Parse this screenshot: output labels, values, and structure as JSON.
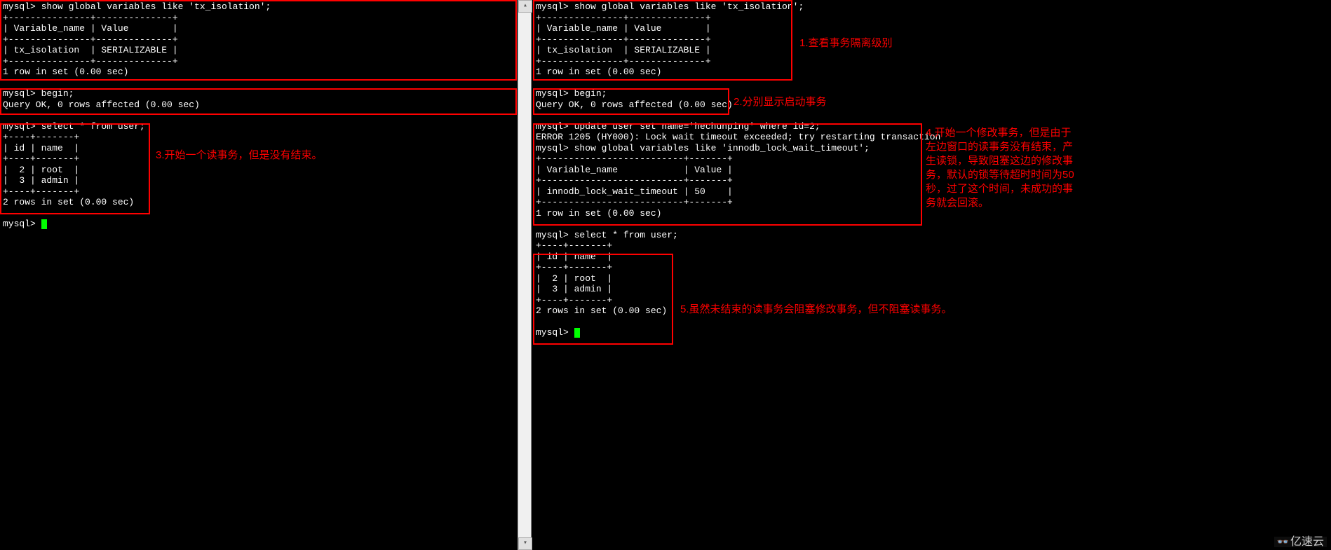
{
  "left": {
    "line1": "mysql> show global variables like 'tx_isolation';",
    "line2": "+---------------+--------------+",
    "line3": "| Variable_name | Value        |",
    "line4": "+---------------+--------------+",
    "line5": "| tx_isolation  | SERIALIZABLE |",
    "line6": "+---------------+--------------+",
    "line7": "1 row in set (0.00 sec)",
    "blank1": "",
    "line8": "mysql> begin;",
    "line9": "Query OK, 0 rows affected (0.00 sec)",
    "blank2": "",
    "line10": "mysql> select * from user;",
    "line11": "+----+-------+",
    "line12": "| id | name  |",
    "line13": "+----+-------+",
    "line14": "|  2 | root  |",
    "line15": "|  3 | admin |",
    "line16": "+----+-------+",
    "line17": "2 rows in set (0.00 sec)",
    "blank3": "",
    "line18": "mysql> "
  },
  "right": {
    "line1": "mysql> show global variables like 'tx_isolation';",
    "line2": "+---------------+--------------+",
    "line3": "| Variable_name | Value        |",
    "line4": "+---------------+--------------+",
    "line5": "| tx_isolation  | SERIALIZABLE |",
    "line6": "+---------------+--------------+",
    "line7": "1 row in set (0.00 sec)",
    "blank1": "",
    "line8": "mysql> begin;",
    "line9": "Query OK, 0 rows affected (0.00 sec)",
    "blank2": "",
    "line10": "mysql> update user set name='hechunping' where id=2;",
    "line11": "ERROR 1205 (HY000): Lock wait timeout exceeded; try restarting transaction",
    "line12": "mysql> show global variables like 'innodb_lock_wait_timeout';",
    "line13": "+--------------------------+-------+",
    "line14": "| Variable_name            | Value |",
    "line15": "+--------------------------+-------+",
    "line16": "| innodb_lock_wait_timeout | 50    |",
    "line17": "+--------------------------+-------+",
    "line18": "1 row in set (0.00 sec)",
    "blank3": "",
    "line19": "mysql> select * from user;",
    "line20": "+----+-------+",
    "line21": "| id | name  |",
    "line22": "+----+-------+",
    "line23": "|  2 | root  |",
    "line24": "|  3 | admin |",
    "line25": "+----+-------+",
    "line26": "2 rows in set (0.00 sec)",
    "blank4": "",
    "line27": "mysql> "
  },
  "annotations": {
    "a1": "1.查看事务隔离级别",
    "a2": "2.分别显示启动事务",
    "a3": "3.开始一个读事务，但是没有结束。",
    "a4": "4.开始一个修改事务，但是由于左边窗口的读事务没有结束，产生读锁，导致阻塞这边的修改事务，默认的锁等待超时时间为50秒，过了这个时间，未成功的事务就会回滚。",
    "a5": "5.虽然未结束的读事务会阻塞修改事务，但不阻塞读事务。"
  },
  "scrollbar": {
    "up": "▴",
    "down": "▾"
  },
  "watermark": "亿速云"
}
